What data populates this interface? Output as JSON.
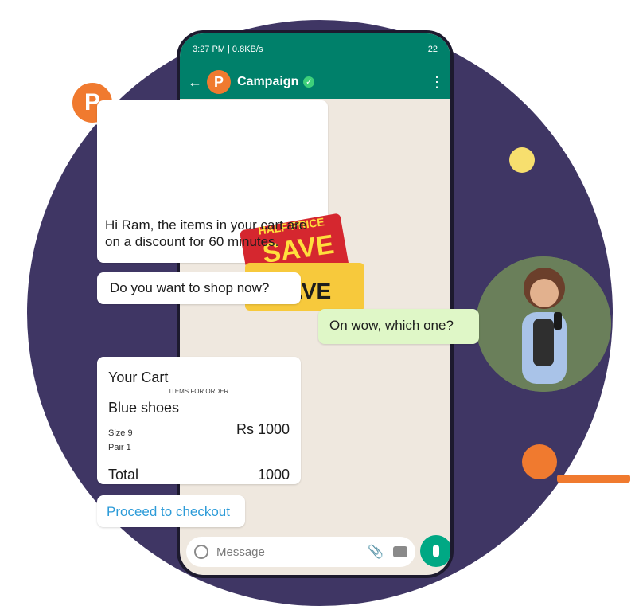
{
  "colors": {
    "background_circle": "#3f3664",
    "brand_orange": "#f07a2f",
    "whatsapp_green": "#00806a",
    "sent_bubble": "#dff7c7",
    "link_blue": "#2c9bd8"
  },
  "decor": {
    "logo_letter": "P",
    "icons": [
      "yellow-dot",
      "orange-dot",
      "orange-dash",
      "woman-avatar"
    ]
  },
  "statusbar": {
    "left": "3:27 PM | 0.8KB/s",
    "right": "22"
  },
  "appbar": {
    "back_icon": "arrow-left-icon",
    "logo_letter": "P",
    "title": "Campaign",
    "verified_icon": "check-icon",
    "menu_icon": "more-vert-icon"
  },
  "coupon": {
    "half_price": "HALF PRICE",
    "save": "SAVE",
    "save2": "SAVE"
  },
  "messages": {
    "m1": "Hi Ram, the items in your cart are on a discount for 60 minutes.",
    "m2": "Do you want to shop now?",
    "m3": "On wow, which one?",
    "cart": {
      "title": "Your Cart",
      "subtitle": "ITEMS FOR ORDER",
      "item": "Blue shoes",
      "size": "Size 9",
      "price": "Rs 1000",
      "pair": "Pair 1",
      "total_label": "Total",
      "total_value": "1000"
    },
    "checkout": "Proceed to checkout"
  },
  "composer": {
    "placeholder": "Message",
    "emoji_icon": "emoji-icon",
    "attach_icon": "paperclip-icon",
    "camera_icon": "camera-icon",
    "mic_icon": "microphone-icon"
  }
}
